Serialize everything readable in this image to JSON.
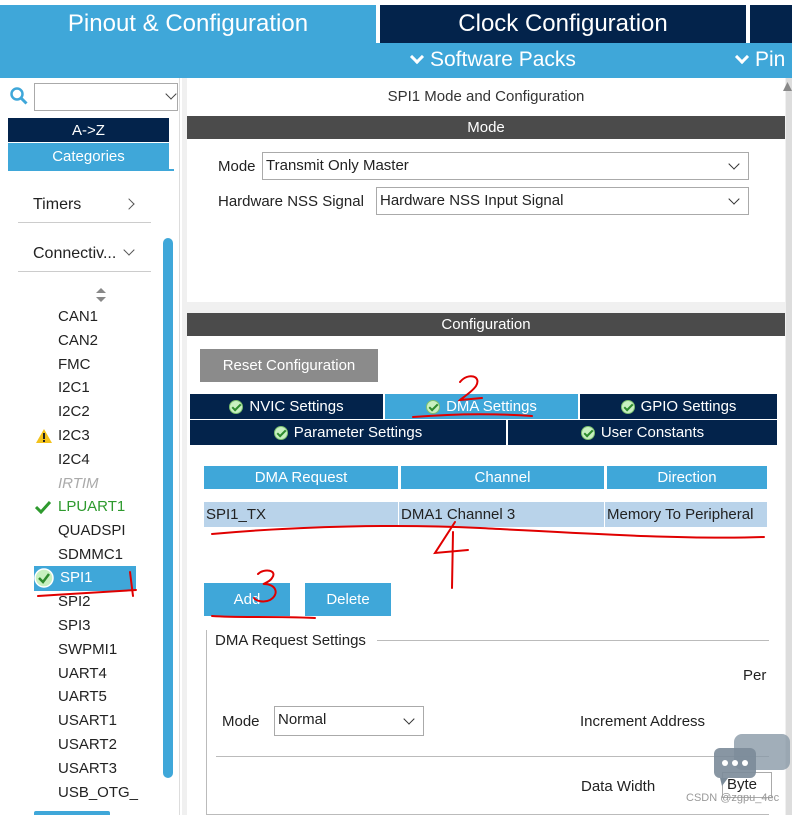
{
  "top_tabs": {
    "pinout": "Pinout & Configuration",
    "clock": "Clock Configuration"
  },
  "sub_bar": {
    "software_packs": "Software Packs",
    "pinout_partial": "Pin"
  },
  "left": {
    "az": "A->Z",
    "categories": "Categories",
    "groups": {
      "timers": "Timers",
      "connectivity": "Connectiv..."
    },
    "items": [
      "CAN1",
      "CAN2",
      "FMC",
      "I2C1",
      "I2C2",
      "I2C3",
      "I2C4",
      "IRTIM",
      "LPUART1",
      "QUADSPI",
      "SDMMC1",
      "SPI1",
      "SPI2",
      "SPI3",
      "SWPMI1",
      "UART4",
      "UART5",
      "USART1",
      "USART2",
      "USART3",
      "USB_OTG_"
    ]
  },
  "main": {
    "title": "SPI1 Mode and Configuration",
    "mode_bar": "Mode",
    "mode_label": "Mode",
    "mode_value": "Transmit Only Master",
    "nss_label": "Hardware NSS Signal",
    "nss_value": "Hardware NSS Input Signal",
    "config_bar": "Configuration",
    "reset_button": "Reset Configuration",
    "tabs": {
      "nvic": "NVIC Settings",
      "dma": "DMA Settings",
      "gpio": "GPIO Settings",
      "parameter": "Parameter Settings",
      "user_constants": "User Constants"
    },
    "table": {
      "headers": [
        "DMA Request",
        "Channel",
        "Direction"
      ],
      "rows": [
        [
          "SPI1_TX",
          "DMA1 Channel 3",
          "Memory To Peripheral"
        ]
      ]
    },
    "add_button": "Add",
    "delete_button": "Delete",
    "dma_request_settings": "DMA Request Settings",
    "per_label": "Per",
    "dma_mode_label": "Mode",
    "dma_mode_value": "Normal",
    "increment_address": "Increment Address",
    "data_width": "Data Width",
    "byte_value": "Byte"
  },
  "annotations": [
    "1",
    "2",
    "3",
    "4"
  ],
  "watermark": "CSDN @zgpu_4ec",
  "colors": {
    "light_blue": "#3fa7d9",
    "dark_navy": "#03234b",
    "dark_gray_bar": "#4b4b4b",
    "selected_row": "#b9d3ea",
    "annotation_red": "#e00000"
  }
}
